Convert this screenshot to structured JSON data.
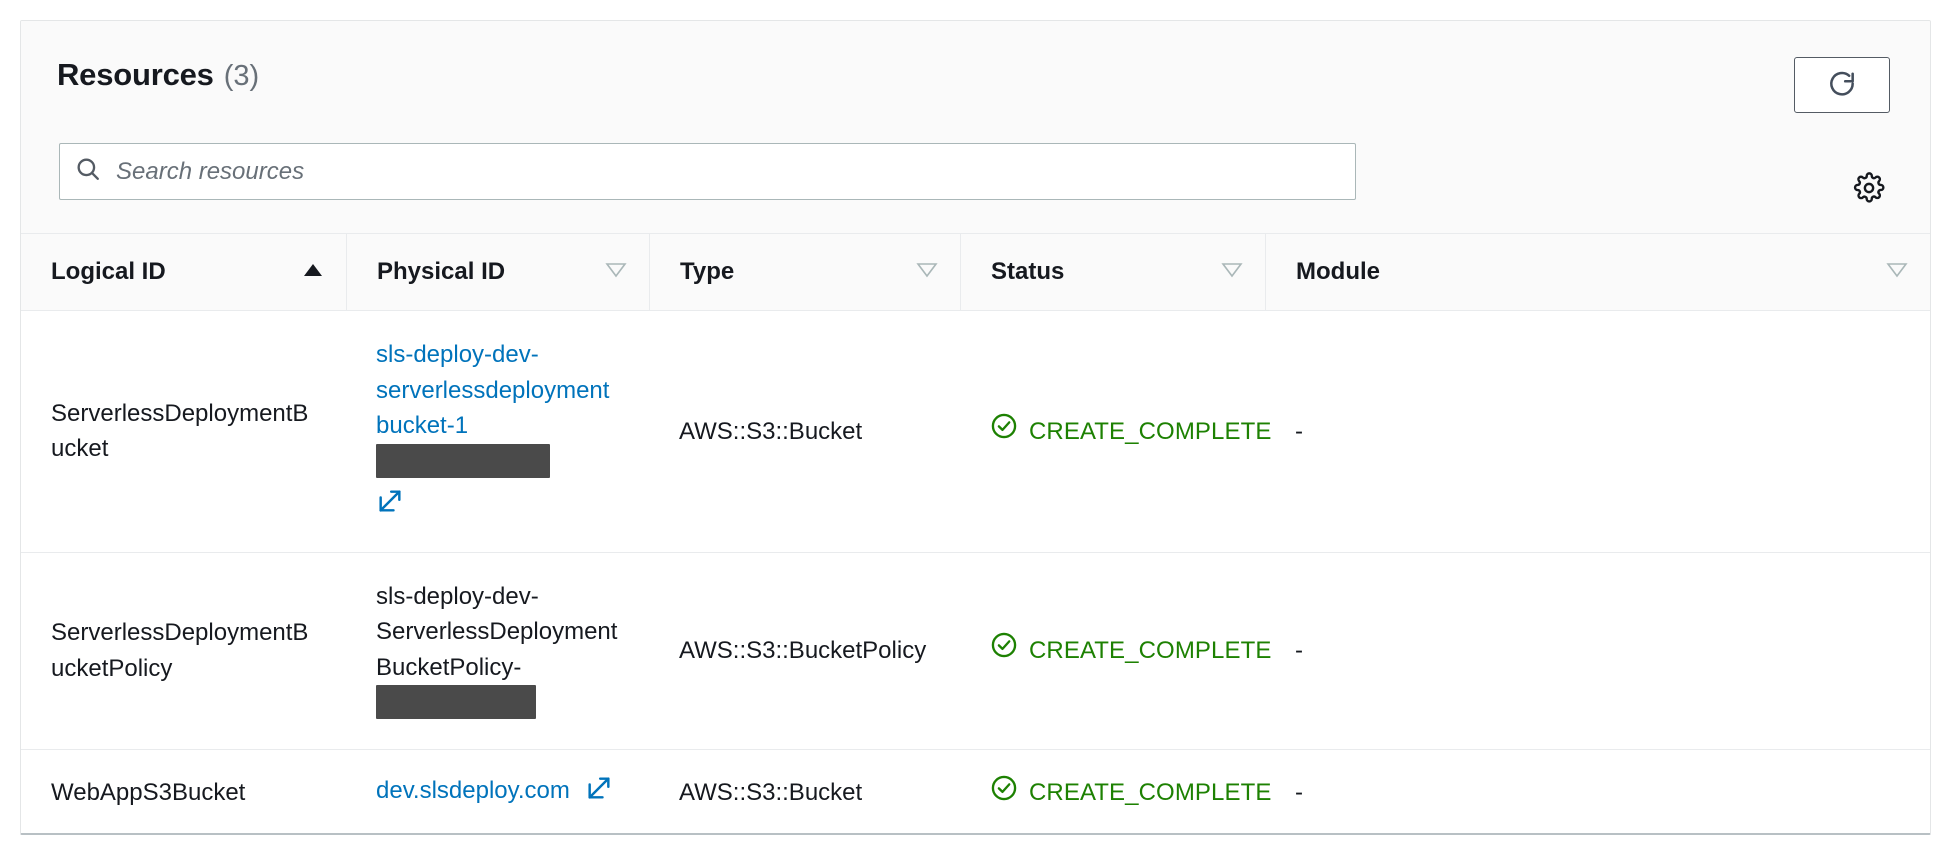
{
  "panel": {
    "title": "Resources",
    "count": "(3)",
    "refresh_label": "Refresh",
    "settings_label": "Preferences"
  },
  "search": {
    "placeholder": "Search resources",
    "value": ""
  },
  "table": {
    "columns": [
      {
        "key": "logical_id",
        "label": "Logical ID",
        "sort": "asc",
        "sort_icon": "sort-ascending-icon"
      },
      {
        "key": "physical_id",
        "label": "Physical ID",
        "sort": "none",
        "sort_icon": "sort-descending-icon"
      },
      {
        "key": "type",
        "label": "Type",
        "sort": "none",
        "sort_icon": "sort-descending-icon"
      },
      {
        "key": "status",
        "label": "Status",
        "sort": "none",
        "sort_icon": "sort-descending-icon"
      },
      {
        "key": "module",
        "label": "Module",
        "sort": "none",
        "sort_icon": "sort-descending-icon"
      }
    ],
    "rows": [
      {
        "logical_id": "ServerlessDeploymentBucket",
        "physical_id_text": "sls-deploy-dev-serverlessdeploymentbucket-1",
        "physical_id_is_link": true,
        "physical_id_redacted": true,
        "physical_id_external_link": true,
        "type": "AWS::S3::Bucket",
        "status": "CREATE_COMPLETE",
        "status_icon": "status-success-icon",
        "module": "-"
      },
      {
        "logical_id": "ServerlessDeploymentBucketPolicy",
        "physical_id_text": "sls-deploy-dev-ServerlessDeploymentBucketPolicy-",
        "physical_id_is_link": false,
        "physical_id_redacted": true,
        "physical_id_external_link": false,
        "type": "AWS::S3::BucketPolicy",
        "status": "CREATE_COMPLETE",
        "status_icon": "status-success-icon",
        "module": "-"
      },
      {
        "logical_id": "WebAppS3Bucket",
        "physical_id_text": "dev.slsdeploy.com",
        "physical_id_is_link": true,
        "physical_id_redacted": false,
        "physical_id_external_link": true,
        "type": "AWS::S3::Bucket",
        "status": "CREATE_COMPLETE",
        "status_icon": "status-success-icon",
        "module": "-"
      }
    ]
  },
  "colors": {
    "link": "#0073bb",
    "status_success": "#1d8102",
    "header_bg": "#fafafa",
    "border": "#e9ebed",
    "text": "#16191f",
    "redaction": "#4a4a4a"
  }
}
